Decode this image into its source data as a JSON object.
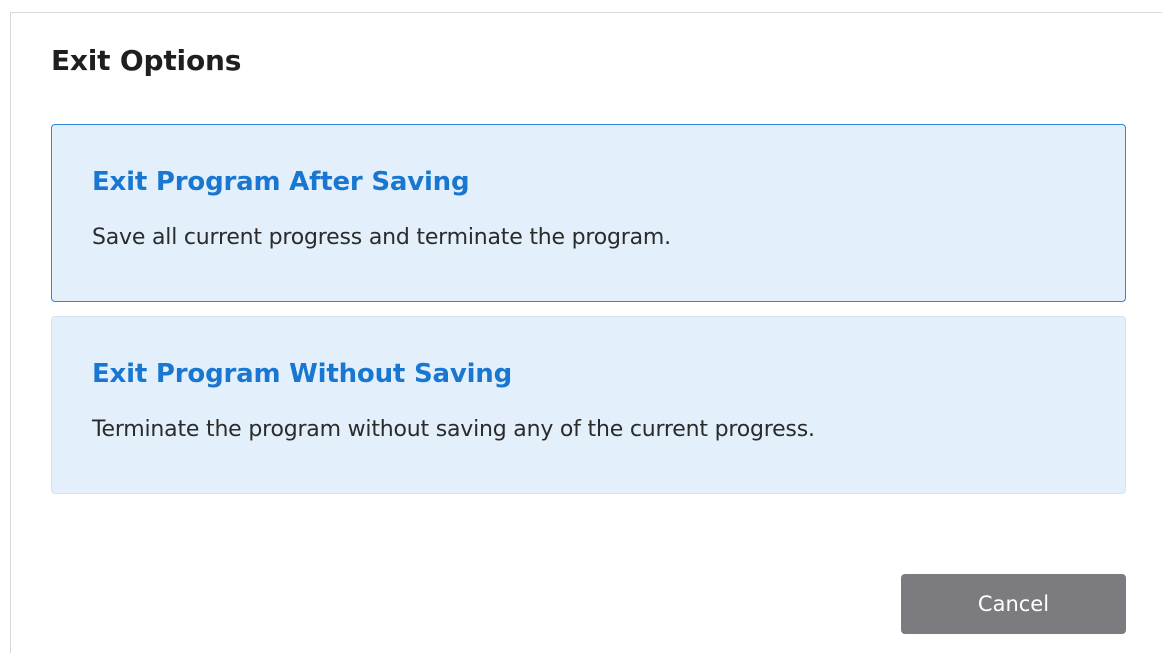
{
  "dialog": {
    "title": "Exit Options",
    "options": [
      {
        "title": "Exit Program After Saving",
        "description": "Save all current progress and terminate the program.",
        "selected": true
      },
      {
        "title": "Exit Program Without Saving",
        "description": "Terminate the program without saving any of the current progress.",
        "selected": false
      }
    ],
    "cancel_label": "Cancel"
  },
  "colors": {
    "accent": "#1977d2",
    "selected_border": "#2f86d6",
    "card_background": "#e3f0fc",
    "cancel_button": "#7c7c80"
  }
}
